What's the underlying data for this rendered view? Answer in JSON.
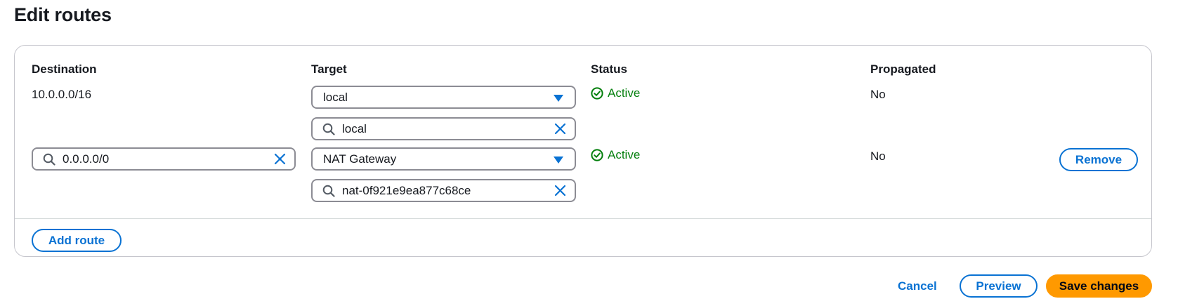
{
  "page": {
    "title": "Edit routes"
  },
  "table": {
    "headers": {
      "destination": "Destination",
      "target": "Target",
      "status": "Status",
      "propagated": "Propagated"
    },
    "routes": [
      {
        "destination": "10.0.0.0/16",
        "target_type": "local",
        "target_search": "local",
        "status": "Active",
        "propagated": "No"
      },
      {
        "destination": "0.0.0.0/0",
        "target_type": "NAT Gateway",
        "target_search": "nat-0f921e9ea877c68ce",
        "status": "Active",
        "propagated": "No",
        "remove_label": "Remove"
      }
    ],
    "add_route_label": "Add route"
  },
  "footer": {
    "cancel_label": "Cancel",
    "preview_label": "Preview",
    "save_label": "Save changes"
  },
  "colors": {
    "link_blue": "#0972d3",
    "status_green": "#037f0c",
    "primary_orange": "#ff9900"
  },
  "icons": {
    "search": "search-icon",
    "clear": "close-icon",
    "dropdown": "caret-down-icon",
    "status": "check-circle-icon"
  }
}
